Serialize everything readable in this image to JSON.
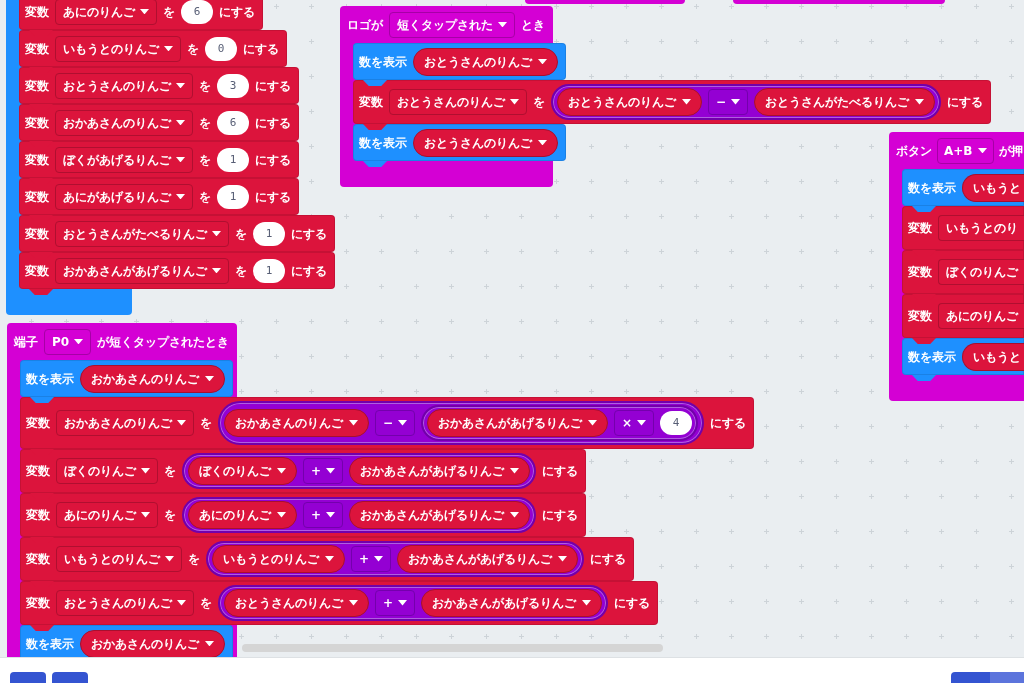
{
  "workspace": {
    "stacks": [
      {
        "kind": "basic",
        "blocks": [
          {
            "kind": "set",
            "label": "変数",
            "variable": "あにのりんご",
            "joiner": "を",
            "value": {
              "kind": "number",
              "text": "6"
            },
            "suffix": "にする"
          },
          {
            "kind": "set",
            "label": "変数",
            "variable": "いもうとのりんご",
            "joiner": "を",
            "value": {
              "kind": "number",
              "text": "0"
            },
            "suffix": "にする"
          },
          {
            "kind": "set",
            "label": "変数",
            "variable": "おとうさんのりんご",
            "joiner": "を",
            "value": {
              "kind": "number",
              "text": "3"
            },
            "suffix": "にする"
          },
          {
            "kind": "set",
            "label": "変数",
            "variable": "おかあさんのりんご",
            "joiner": "を",
            "value": {
              "kind": "number",
              "text": "6"
            },
            "suffix": "にする"
          },
          {
            "kind": "set",
            "label": "変数",
            "variable": "ぼくがあげるりんご",
            "joiner": "を",
            "value": {
              "kind": "number",
              "text": "1"
            },
            "suffix": "にする"
          },
          {
            "kind": "set",
            "label": "変数",
            "variable": "あにがあげるりんご",
            "joiner": "を",
            "value": {
              "kind": "number",
              "text": "1"
            },
            "suffix": "にする"
          },
          {
            "kind": "set",
            "label": "変数",
            "variable": "おとうさんがたべるりんご",
            "joiner": "を",
            "value": {
              "kind": "number",
              "text": "1"
            },
            "suffix": "にする"
          },
          {
            "kind": "set",
            "label": "変数",
            "variable": "おかあさんがあげるりんご",
            "joiner": "を",
            "value": {
              "kind": "number",
              "text": "1"
            },
            "suffix": "にする"
          }
        ]
      },
      {
        "kind": "event",
        "header": [
          {
            "kind": "label",
            "text": "ロゴが"
          },
          {
            "kind": "dropdown",
            "text": "短くタップされた"
          },
          {
            "kind": "label",
            "text": "とき"
          }
        ],
        "blocks": [
          {
            "kind": "show_number",
            "label": "数を表示",
            "value": {
              "kind": "variable",
              "name": "おとうさんのりんご"
            }
          },
          {
            "kind": "set",
            "label": "変数",
            "variable": "おとうさんのりんご",
            "joiner": "を",
            "value": {
              "kind": "math",
              "left": {
                "kind": "variable",
                "name": "おとうさんのりんご"
              },
              "operator": "−",
              "right": {
                "kind": "variable",
                "name": "おとうさんがたべるりんご"
              }
            },
            "suffix": "にする"
          },
          {
            "kind": "show_number",
            "label": "数を表示",
            "value": {
              "kind": "variable",
              "name": "おとうさんのりんご"
            }
          }
        ]
      },
      {
        "kind": "event",
        "header": [
          {
            "kind": "label",
            "text": "ボタン"
          },
          {
            "kind": "dropdown",
            "text": "A+B"
          },
          {
            "kind": "label",
            "text": "が押"
          }
        ],
        "blocks": [
          {
            "kind": "show_number",
            "label": "数を表示",
            "value": {
              "kind": "variable",
              "name": "いもうと"
            }
          },
          {
            "kind": "set",
            "label": "変数",
            "variable": "いもうとのり"
          },
          {
            "kind": "set",
            "label": "変数",
            "variable": "ぼくのりんご"
          },
          {
            "kind": "set",
            "label": "変数",
            "variable": "あにのりんご"
          },
          {
            "kind": "show_number",
            "label": "数を表示",
            "value": {
              "kind": "variable",
              "name": "いもうと"
            }
          }
        ]
      },
      {
        "kind": "event",
        "header": [
          {
            "kind": "label",
            "text": "端子"
          },
          {
            "kind": "dropdown",
            "text": "P0"
          },
          {
            "kind": "label",
            "text": "が短くタップされたとき"
          }
        ],
        "blocks": [
          {
            "kind": "show_number",
            "label": "数を表示",
            "value": {
              "kind": "variable",
              "name": "おかあさんのりんご"
            }
          },
          {
            "kind": "set",
            "label": "変数",
            "variable": "おかあさんのりんご",
            "joiner": "を",
            "value": {
              "kind": "math",
              "left": {
                "kind": "variable",
                "name": "おかあさんのりんご"
              },
              "operator": "−",
              "right": {
                "kind": "math",
                "left": {
                  "kind": "variable",
                  "name": "おかあさんがあげるりんご"
                },
                "operator": "×",
                "right": {
                  "kind": "number",
                  "text": "4"
                }
              }
            },
            "suffix": "にする"
          },
          {
            "kind": "set",
            "label": "変数",
            "variable": "ぼくのりんご",
            "joiner": "を",
            "value": {
              "kind": "math",
              "left": {
                "kind": "variable",
                "name": "ぼくのりんご"
              },
              "operator": "+",
              "right": {
                "kind": "variable",
                "name": "おかあさんがあげるりんご"
              }
            },
            "suffix": "にする"
          },
          {
            "kind": "set",
            "label": "変数",
            "variable": "あにのりんご",
            "joiner": "を",
            "value": {
              "kind": "math",
              "left": {
                "kind": "variable",
                "name": "あにのりんご"
              },
              "operator": "+",
              "right": {
                "kind": "variable",
                "name": "おかあさんがあげるりんご"
              }
            },
            "suffix": "にする"
          },
          {
            "kind": "set",
            "label": "変数",
            "variable": "いもうとのりんご",
            "joiner": "を",
            "value": {
              "kind": "math",
              "left": {
                "kind": "variable",
                "name": "いもうとのりんご"
              },
              "operator": "+",
              "right": {
                "kind": "variable",
                "name": "おかあさんがあげるりんご"
              }
            },
            "suffix": "にする"
          },
          {
            "kind": "set",
            "label": "変数",
            "variable": "おとうさんのりんご",
            "joiner": "を",
            "value": {
              "kind": "math",
              "left": {
                "kind": "variable",
                "name": "おとうさんのりんご"
              },
              "operator": "+",
              "right": {
                "kind": "variable",
                "name": "おかあさんがあげるりんご"
              }
            },
            "suffix": "にする"
          },
          {
            "kind": "show_number",
            "label": "数を表示",
            "value": {
              "kind": "variable",
              "name": "おかあさんのりんご"
            }
          }
        ]
      }
    ]
  }
}
